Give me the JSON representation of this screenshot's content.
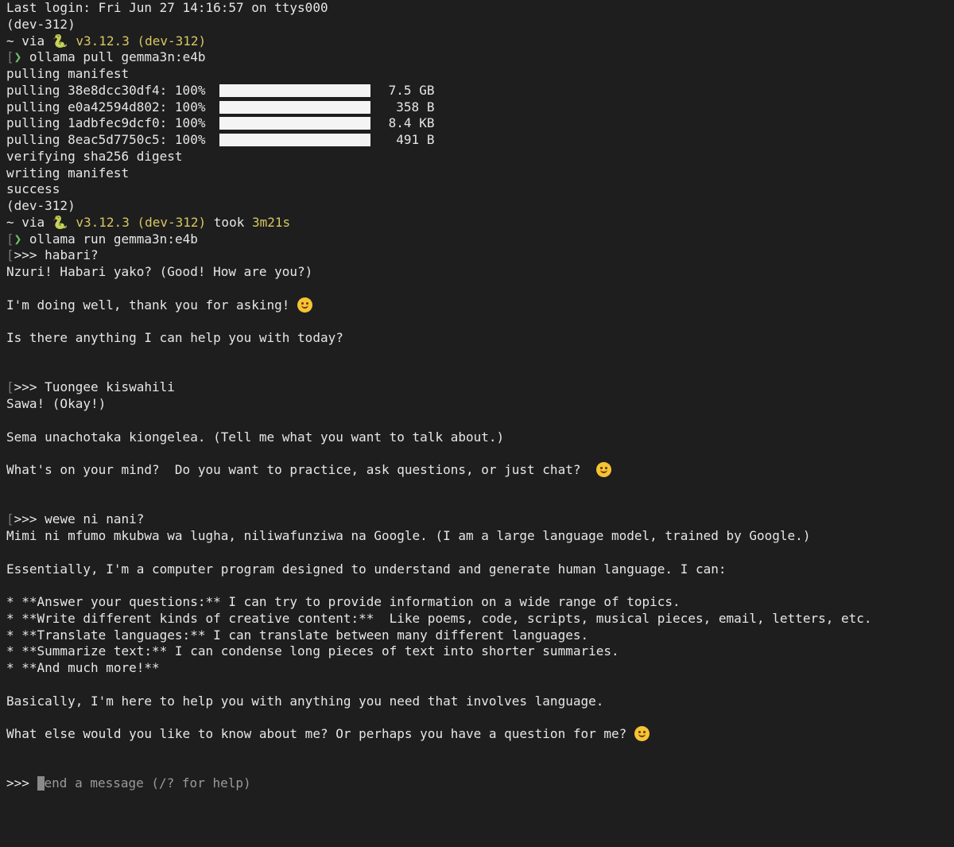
{
  "login_line": "Last login: Fri Jun 27 14:16:57 on ttys000",
  "env": "(dev-312)",
  "prompt": {
    "tilde": "~",
    "via": "via",
    "python_version": "v3.12.3 (dev-312)",
    "took_label": "took",
    "took_value": "3m21s"
  },
  "commands": {
    "pull": "ollama pull gemma3n:e4b",
    "run": "ollama run gemma3n:e4b"
  },
  "pull_output": {
    "manifest": "pulling manifest",
    "layers": [
      {
        "label": "pulling 38e8dcc30df4: 100%",
        "progress": 1.0,
        "size": "7.5 GB"
      },
      {
        "label": "pulling e0a42594d802: 100%",
        "progress": 1.0,
        "size": "358 B"
      },
      {
        "label": "pulling 1adbfec9dcf0: 100%",
        "progress": 1.0,
        "size": "8.4 KB"
      },
      {
        "label": "pulling 8eac5d7750c5: 100%",
        "progress": 1.0,
        "size": "491 B"
      }
    ],
    "verifying": "verifying sha256 digest",
    "writing": "writing manifest",
    "success": "success"
  },
  "chat": {
    "q1": ">>> habari?",
    "a1_l1": "Nzuri! Habari yako? (Good! How are you?)",
    "a1_l2": "I'm doing well, thank you for asking! ",
    "a1_l3": "Is there anything I can help you with today?",
    "q2": ">>> Tuongee kiswahili",
    "a2_l1": "Sawa! (Okay!)",
    "a2_l2": "Sema unachotaka kiongelea. (Tell me what you want to talk about.)",
    "a2_l3": "What's on your mind?  Do you want to practice, ask questions, or just chat?  ",
    "q3": ">>> wewe ni nani?",
    "a3_l1": "Mimi ni mfumo mkubwa wa lugha, niliwafunziwa na Google. (I am a large language model, trained by Google.)",
    "a3_l2": "Essentially, I'm a computer program designed to understand and generate human language. I can:",
    "bullets": [
      "* **Answer your questions:** I can try to provide information on a wide range of topics.",
      "* **Write different kinds of creative content:**  Like poems, code, scripts, musical pieces, email, letters, etc.",
      "* **Translate languages:** I can translate between many different languages.",
      "* **Summarize text:** I can condense long pieces of text into shorter summaries.",
      "* **And much more!**"
    ],
    "a3_l3": "Basically, I'm here to help you with anything you need that involves language.",
    "a3_l4": "What else would you like to know about me? Or perhaps you have a question for me? "
  },
  "input": {
    "prompt": ">>> ",
    "placeholder": "end a message (/? for help)"
  },
  "icons": {
    "prompt_chevron": "chevron-right-icon",
    "python": "python-snake-icon",
    "smile": "smiling-face-emoji"
  },
  "colors": {
    "background": "#1e1e1e",
    "text": "#e6e6e6",
    "accent_yellow": "#d8c763",
    "chevron_green": "#6fc46f"
  }
}
